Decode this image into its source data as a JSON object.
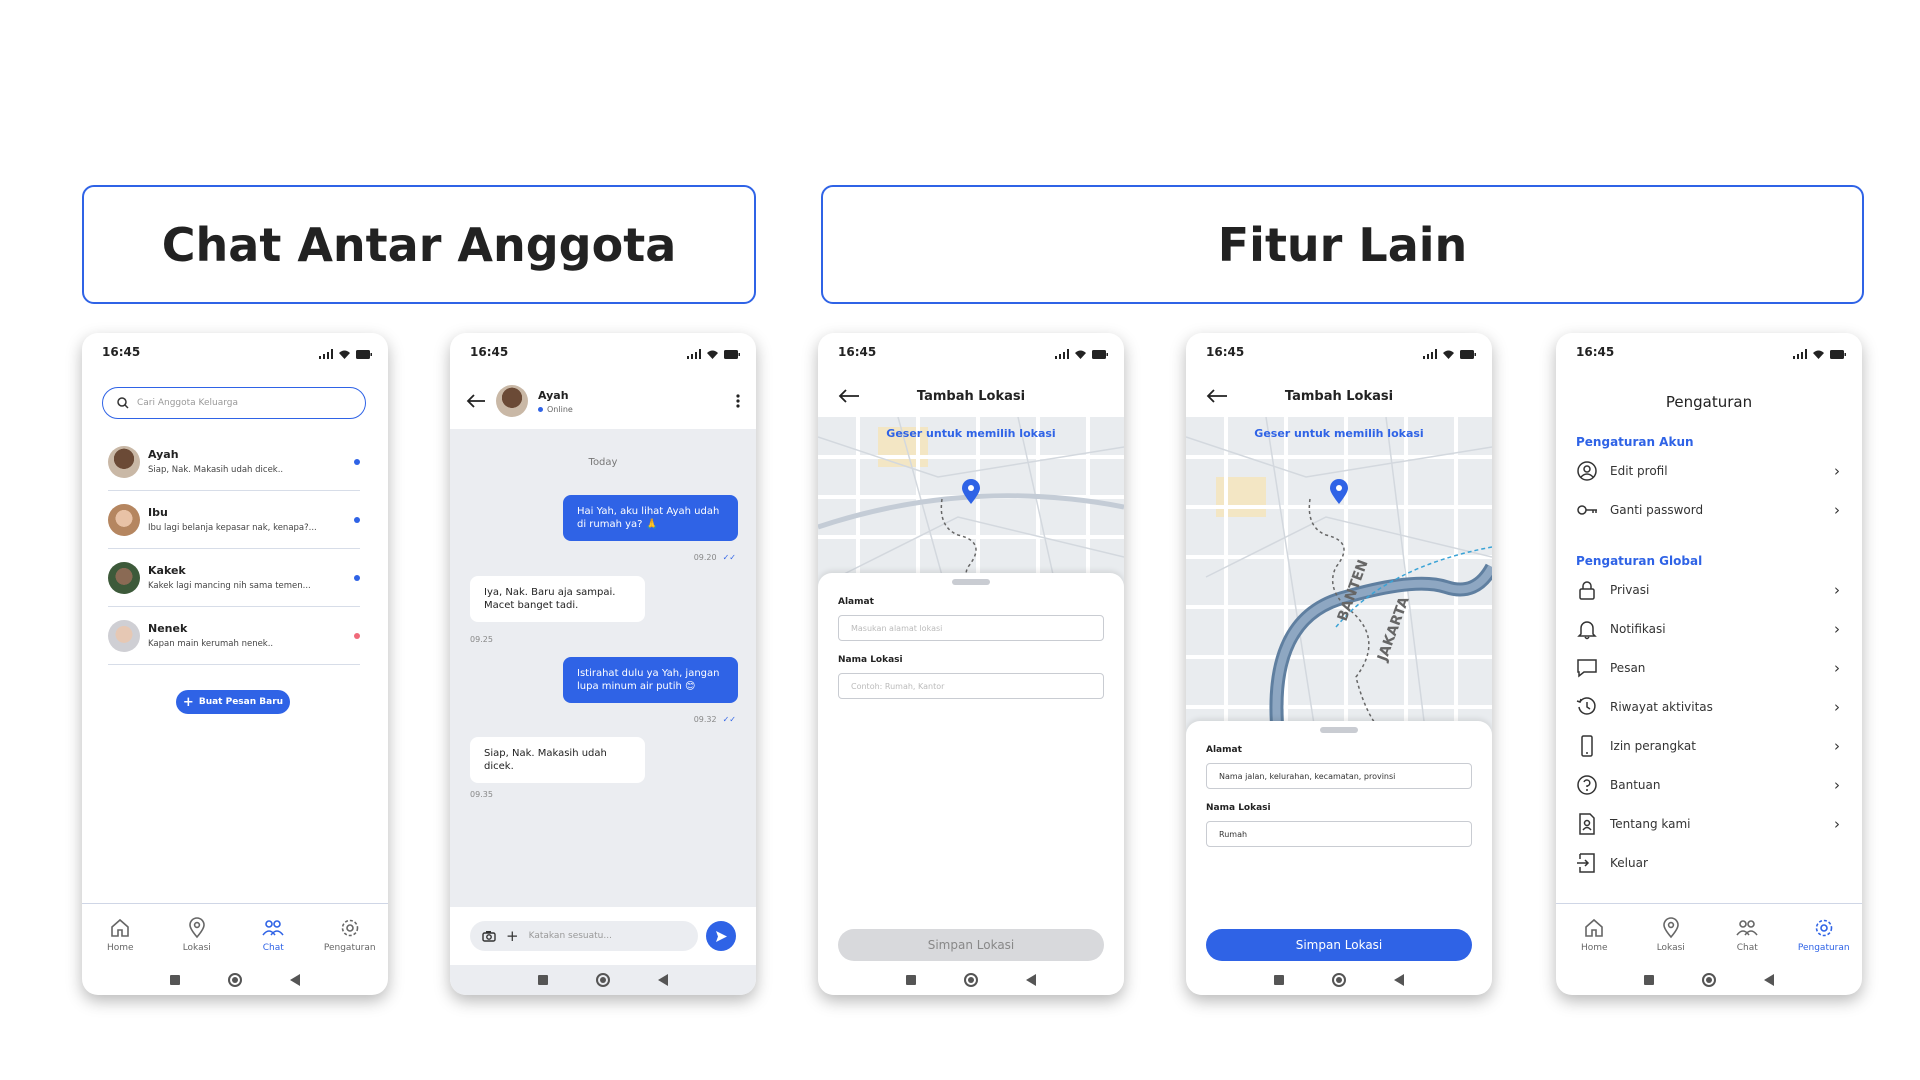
{
  "sections": {
    "chat_title": "Chat Antar Anggota",
    "features_title": "Fitur Lain"
  },
  "status_time": "16:45",
  "tabs": {
    "home": "Home",
    "lokasi": "Lokasi",
    "chat": "Chat",
    "pengaturan": "Pengaturan"
  },
  "chat_list": {
    "search_placeholder": "Cari Anggota Keluarga",
    "items": [
      {
        "name": "Ayah",
        "message": "Siap, Nak. Makasih udah dicek..",
        "dot_color": "#2f63e6"
      },
      {
        "name": "Ibu",
        "message": "Ibu lagi belanja kepasar nak, kenapa?...",
        "dot_color": "#2f63e6"
      },
      {
        "name": "Kakek",
        "message": "Kakek lagi mancing nih sama temen...",
        "dot_color": "#2f63e6"
      },
      {
        "name": "Nenek",
        "message": "Kapan main kerumah nenek..",
        "dot_color": "#f06a7a"
      }
    ],
    "new_message_button": "Buat Pesan Baru"
  },
  "conversation": {
    "contact_name": "Ayah",
    "contact_status": "Online",
    "day_label": "Today",
    "messages": [
      {
        "direction": "out",
        "text": "Hai Yah, aku lihat Ayah udah di rumah ya? 🙏",
        "time": "09.20"
      },
      {
        "direction": "in",
        "text": "Iya, Nak. Baru aja sampai. Macet banget tadi.",
        "time": "09.25"
      },
      {
        "direction": "out",
        "text": "Istirahat dulu ya Yah, jangan lupa minum air putih 😊",
        "time": "09.32"
      },
      {
        "direction": "in",
        "text": "Siap, Nak. Makasih udah dicek.",
        "time": "09.35"
      }
    ],
    "input_placeholder": "Katakan sesuatu..."
  },
  "add_location_empty": {
    "title": "Tambah Lokasi",
    "map_hint": "Geser untuk memilih lokasi",
    "address_label": "Alamat",
    "address_placeholder": "Masukan alamat lokasi",
    "name_label": "Nama Lokasi",
    "name_placeholder": "Contoh: Rumah, Kantor",
    "save_button": "Simpan Lokasi"
  },
  "add_location_filled": {
    "title": "Tambah Lokasi",
    "map_hint": "Geser untuk memilih lokasi",
    "map_labels": [
      "BANTEN",
      "JAKARTA"
    ],
    "address_label": "Alamat",
    "address_value": "Nama jalan, kelurahan, kecamatan, provinsi",
    "name_label": "Nama Lokasi",
    "name_value": "Rumah",
    "save_button": "Simpan Lokasi"
  },
  "settings": {
    "title": "Pengaturan",
    "account_section": "Pengaturan Akun",
    "account_items": [
      "Edit profil",
      "Ganti password"
    ],
    "global_section": "Pengaturan Global",
    "global_items": [
      "Privasi",
      "Notifikasi",
      "Pesan",
      "Riwayat aktivitas",
      "Izin perangkat",
      "Bantuan",
      "Tentang kami",
      "Keluar"
    ]
  },
  "colors": {
    "accent": "#2f63e6",
    "disabled": "#d8d9dc"
  }
}
